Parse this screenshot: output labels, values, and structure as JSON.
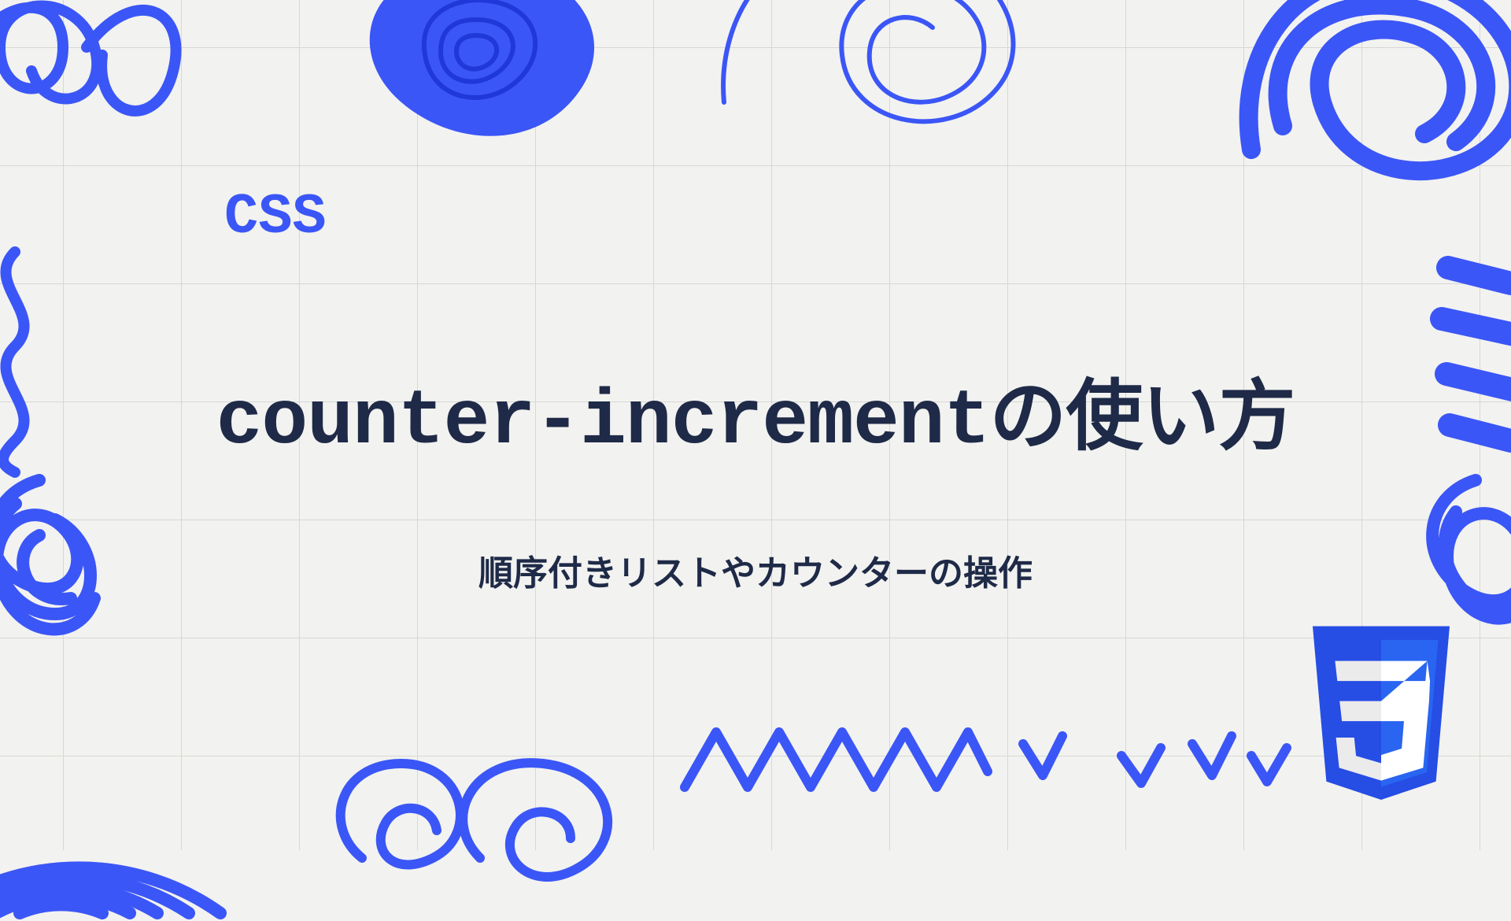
{
  "category_label": "CSS",
  "title": "counter-incrementの使い方",
  "subtitle": "順序付きリストやカウンターの操作",
  "logo": {
    "digit": "3"
  },
  "colors": {
    "accent": "#3b56f6",
    "text": "#1e2a47",
    "bg": "#f2f2f0",
    "grid": "#d7d7d4"
  }
}
